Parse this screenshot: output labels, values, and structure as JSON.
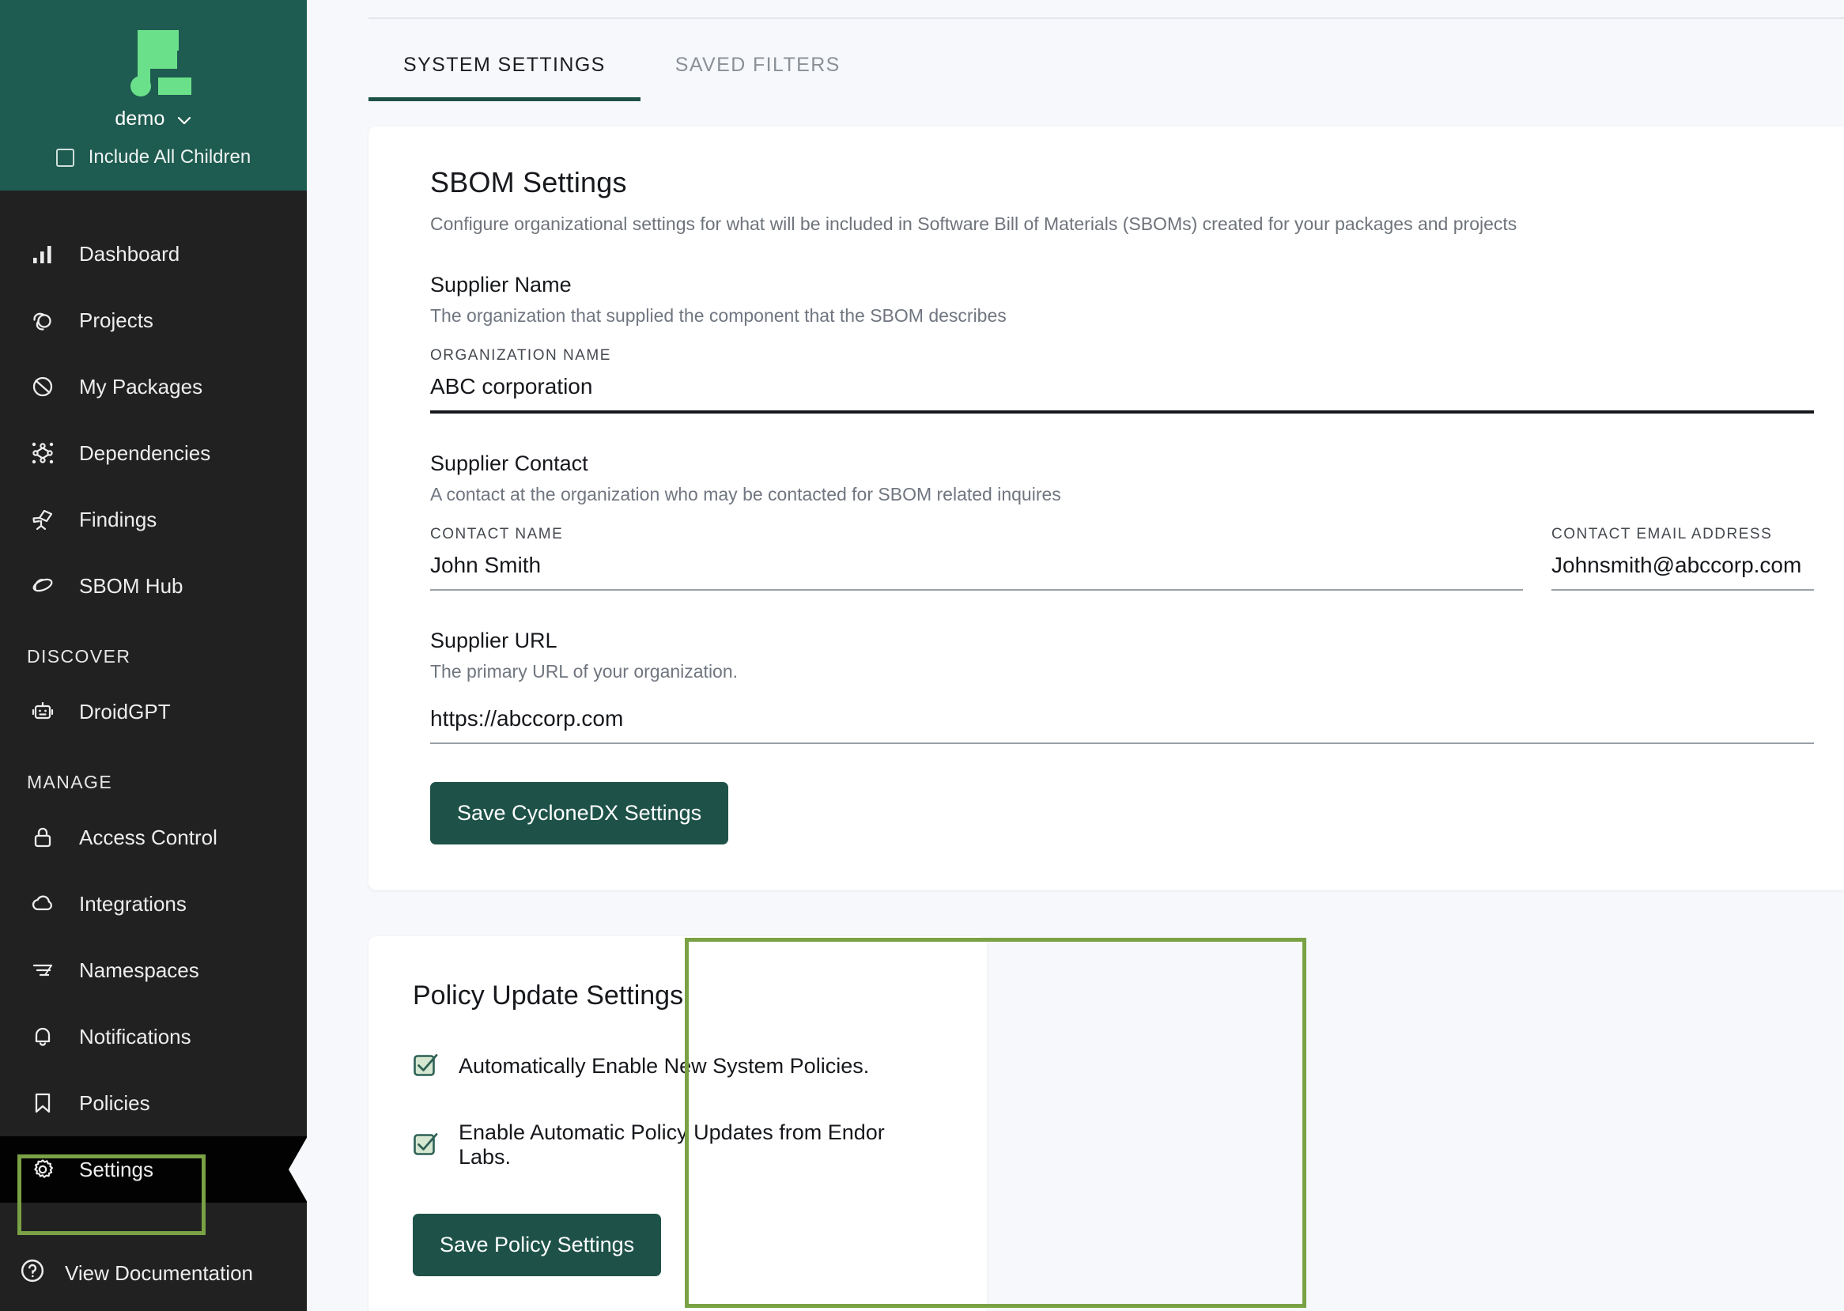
{
  "sidebar": {
    "org_name": "demo",
    "include_all_children_label": "Include All Children",
    "nav_items": [
      {
        "label": "Dashboard",
        "icon": "bar-chart-icon"
      },
      {
        "label": "Projects",
        "icon": "projects-spiral-icon"
      },
      {
        "label": "My Packages",
        "icon": "package-orbit-icon"
      },
      {
        "label": "Dependencies",
        "icon": "dependency-graph-icon"
      },
      {
        "label": "Findings",
        "icon": "telescope-icon"
      },
      {
        "label": "SBOM Hub",
        "icon": "saturn-icon"
      }
    ],
    "discover_section": "DISCOVER",
    "discover_items": [
      {
        "label": "DroidGPT",
        "icon": "robot-icon"
      }
    ],
    "manage_section": "MANAGE",
    "manage_items": [
      {
        "label": "Access Control",
        "icon": "lock-icon"
      },
      {
        "label": "Integrations",
        "icon": "cloud-icon"
      },
      {
        "label": "Namespaces",
        "icon": "namespaces-icon"
      },
      {
        "label": "Notifications",
        "icon": "bell-icon"
      },
      {
        "label": "Policies",
        "icon": "bookmark-icon"
      },
      {
        "label": "Settings",
        "icon": "gear-icon"
      }
    ],
    "documentation_label": "View Documentation"
  },
  "tabs": [
    {
      "label": "SYSTEM SETTINGS",
      "active": true
    },
    {
      "label": "SAVED FILTERS",
      "active": false
    }
  ],
  "sbom": {
    "title": "SBOM Settings",
    "subtitle": "Configure organizational settings for what will be included in Software Bill of Materials (SBOMs) created for your packages and projects",
    "supplier_name": {
      "title": "Supplier Name",
      "description": "The organization that supplied the component that the SBOM describes",
      "org_field_label": "ORGANIZATION NAME",
      "org_field_value": "ABC corporation"
    },
    "supplier_contact": {
      "title": "Supplier Contact",
      "description": "A contact at the organization who may be contacted for SBOM related inquires",
      "name_field_label": "CONTACT NAME",
      "name_field_value": "John Smith",
      "email_field_label": "CONTACT EMAIL ADDRESS",
      "email_field_value": "Johnsmith@abccorp.com"
    },
    "supplier_url": {
      "title": "Supplier URL",
      "description": "The primary URL of your organization.",
      "value": "https://abccorp.com"
    },
    "save_button": "Save CycloneDX Settings"
  },
  "policy": {
    "title": "Policy Update Settings",
    "checkboxes": [
      {
        "label": "Automatically Enable New System Policies.",
        "checked": true
      },
      {
        "label": "Enable Automatic Policy Updates from Endor Labs.",
        "checked": true
      }
    ],
    "save_button": "Save Policy Settings"
  },
  "colors": {
    "sidebar_bg": "#212121",
    "org_header_bg": "#1e5b50",
    "brand_green": "#6ae08a",
    "accent_teal": "#1e5248",
    "highlight_green": "#7aa245",
    "page_bg": "#f6f8fb",
    "checkbox_fill": "#d6e7d1"
  }
}
